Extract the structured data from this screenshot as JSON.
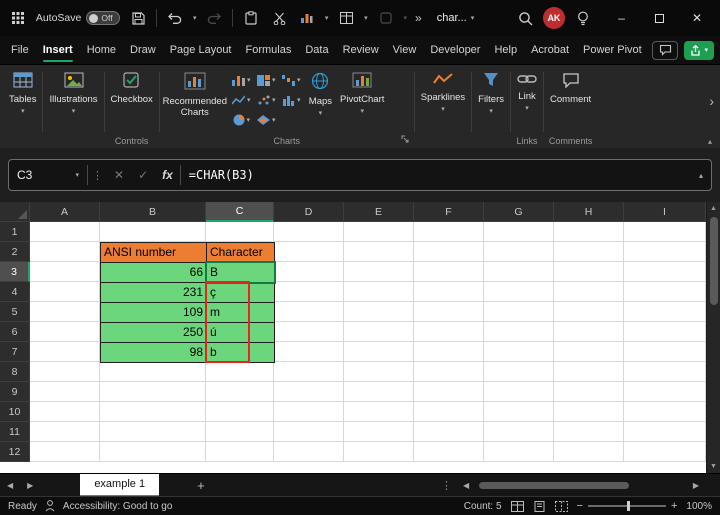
{
  "icons": {
    "chevron_down": "▾",
    "chevron_up": "▴",
    "cancel": "✕",
    "enter": "✓",
    "fx": "fx",
    "overflow": "»",
    "dots": "⋮",
    "tri_left": "◀",
    "tri_right": "▶",
    "minus": "−",
    "plus": "+",
    "minimize": "–",
    "close": "✕",
    "more": "›",
    "add_sheet": "+"
  },
  "titlebar": {
    "autosave_label": "AutoSave",
    "autosave_state": "Off",
    "doc_dropdown": "char...",
    "avatar": "AK",
    "avatar_color": "#BF2E2E"
  },
  "menubar": {
    "tabs": [
      {
        "label": "File",
        "active": false
      },
      {
        "label": "Insert",
        "active": true
      },
      {
        "label": "Home",
        "active": false
      },
      {
        "label": "Draw",
        "active": false
      },
      {
        "label": "Page Layout",
        "active": false
      },
      {
        "label": "Formulas",
        "active": false
      },
      {
        "label": "Data",
        "active": false
      },
      {
        "label": "Review",
        "active": false
      },
      {
        "label": "View",
        "active": false
      },
      {
        "label": "Developer",
        "active": false
      },
      {
        "label": "Help",
        "active": false
      },
      {
        "label": "Acrobat",
        "active": false
      },
      {
        "label": "Power Pivot",
        "active": false
      }
    ]
  },
  "ribbon": {
    "tables_label": "Tables",
    "illustrations_label": "Illustrations",
    "checkbox_label": "Checkbox",
    "controls_group": "Controls",
    "recommended_charts_label": "Recommended Charts",
    "charts_group": "Charts",
    "maps_label": "Maps",
    "pivotchart_label": "PivotChart",
    "sparklines_label": "Sparklines",
    "filters_label": "Filters",
    "link_label": "Link",
    "links_group": "Links",
    "comment_label": "Comment",
    "comments_group": "Comments"
  },
  "formula_bar": {
    "name_box": "C3",
    "formula": "=CHAR(B3)"
  },
  "grid": {
    "columns": [
      "A",
      "B",
      "C",
      "D",
      "E",
      "F",
      "G",
      "H",
      "I"
    ],
    "row_count": 12,
    "active_cell": "C3",
    "selected_column": "C",
    "selected_row": 3,
    "cells": [
      {
        "ref": "B2",
        "text": "ANSI number",
        "kind": "header"
      },
      {
        "ref": "C2",
        "text": "Character",
        "kind": "header"
      },
      {
        "ref": "B3",
        "text": "66",
        "kind": "num"
      },
      {
        "ref": "B4",
        "text": "231",
        "kind": "num"
      },
      {
        "ref": "B5",
        "text": "109",
        "kind": "num"
      },
      {
        "ref": "B6",
        "text": "250",
        "kind": "num"
      },
      {
        "ref": "B7",
        "text": "98",
        "kind": "num"
      },
      {
        "ref": "C3",
        "text": "B",
        "kind": "char"
      },
      {
        "ref": "C4",
        "text": "ç",
        "kind": "char"
      },
      {
        "ref": "C5",
        "text": "m",
        "kind": "char"
      },
      {
        "ref": "C6",
        "text": "ú",
        "kind": "char"
      },
      {
        "ref": "C7",
        "text": "b",
        "kind": "char"
      }
    ],
    "colors": {
      "header_fill": "#ED7D31",
      "data_fill": "#6BD67C",
      "annotation_border": "#E8251D",
      "selection": "#107C41"
    },
    "annotation": {
      "range": "C4:C7"
    }
  },
  "sheet_bar": {
    "tabs": [
      {
        "label": "example 1",
        "active": true
      }
    ]
  },
  "status_bar": {
    "ready": "Ready",
    "accessibility": "Accessibility: Good to go",
    "count": "Count: 5",
    "zoom": "100%"
  }
}
